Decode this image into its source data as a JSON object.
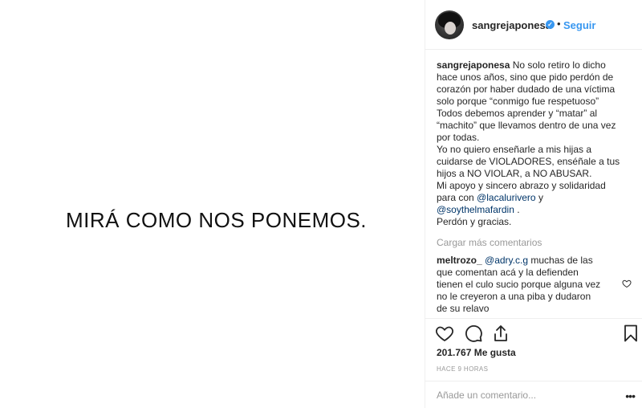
{
  "post": {
    "media_text": "MIRÁ COMO NOS PONEMOS."
  },
  "header": {
    "username": "sangrejaponesa",
    "separator": "•",
    "follow_label": "Seguir"
  },
  "caption": {
    "username": "sangrejaponesa",
    "line1": "No solo retiro lo dicho",
    "line2": "hace unos años, sino que pido perdón de",
    "line3": "corazón por haber dudado de una víctima",
    "line4": "solo porque “conmigo fue respetuoso”",
    "line5": "Todos debemos aprender y “matar” al",
    "line6": "“machito” que llevamos dentro de una vez",
    "line7": "por todas.",
    "line8": "Yo no quiero enseñarle a mis hijas a",
    "line9": "cuidarse de VIOLADORES, enséñale a tus",
    "line10": "hijos a NO VIOLAR, a NO ABUSAR.",
    "line11": "Mi apoyo y sincero abrazo y solidaridad",
    "line12_prefix": "para con",
    "mention1": "@lacalurivero",
    "line12_suffix": "y",
    "mention2": "@soythelmafardin",
    "line13_suffix": ".",
    "line14": "Perdón y gracias."
  },
  "load_more_label": "Cargar más comentarios",
  "comment": {
    "username": "meltrozo_",
    "mention": "@adry.c.g",
    "line1": "muchas de las",
    "line2": "que comentan acá y la defienden",
    "line3": "tienen el culo sucio porque alguna vez",
    "line4": "no le creyeron a una piba y dudaron",
    "line5": "de su relavo"
  },
  "likes_text": "201.767 Me gusta",
  "time_text": "HACE 9 HORAS",
  "add_comment": {
    "placeholder": "Añade un comentario...",
    "more": "•••"
  },
  "icons": {
    "verified": "verified-badge-icon",
    "like": "heart-icon",
    "comment": "comment-bubble-icon",
    "share": "share-icon",
    "save": "bookmark-icon"
  },
  "colors": {
    "link_blue": "#3897f0",
    "mention": "#003569",
    "muted": "#999999",
    "text": "#262626"
  }
}
